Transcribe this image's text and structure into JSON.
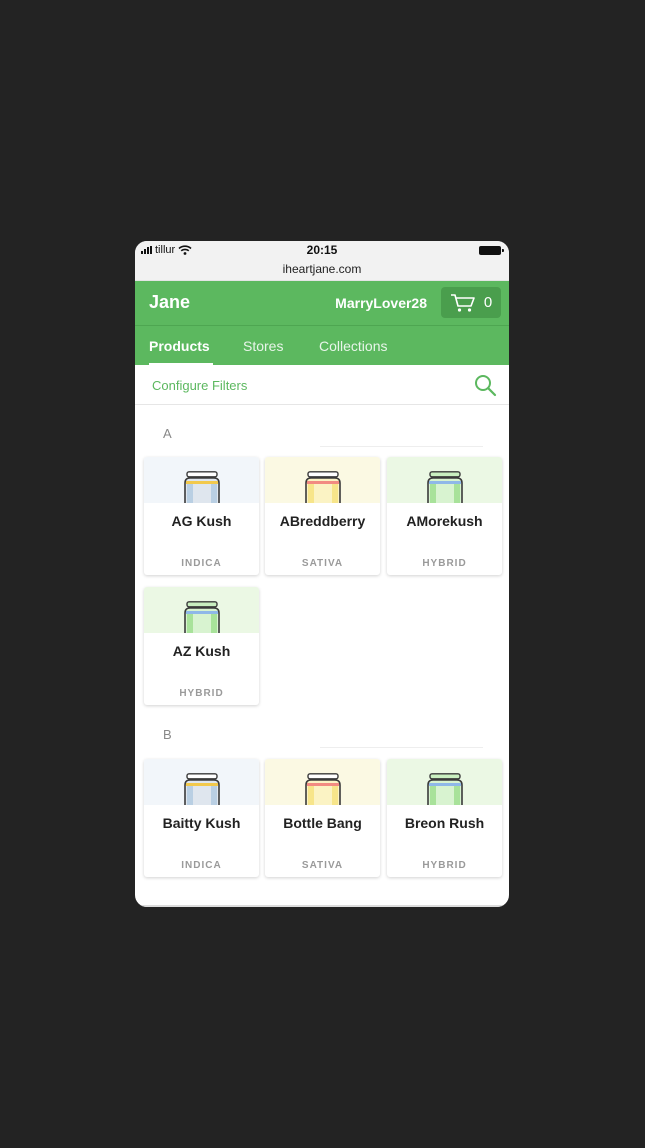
{
  "status": {
    "carrier": "tillur",
    "time": "20:15"
  },
  "browser": {
    "url": "iheartjane.com"
  },
  "header": {
    "brand": "Jane",
    "username": "MarryLover28",
    "cart_count": "0"
  },
  "tabs": [
    {
      "label": "Products",
      "active": true
    },
    {
      "label": "Stores",
      "active": false
    },
    {
      "label": "Collections",
      "active": false
    }
  ],
  "filters": {
    "configure_label": "Configure Filters"
  },
  "sections": [
    {
      "letter": "A",
      "products": [
        {
          "name": "AG Kush",
          "type": "INDICA"
        },
        {
          "name": "ABreddberry",
          "type": "SATIVA"
        },
        {
          "name": "AMorekush",
          "type": "HYBRID"
        },
        {
          "name": "AZ Kush",
          "type": "HYBRID"
        }
      ]
    },
    {
      "letter": "B",
      "products": [
        {
          "name": "Baitty Kush",
          "type": "INDICA"
        },
        {
          "name": "Bottle Bang",
          "type": "SATIVA"
        },
        {
          "name": "Breon Rush",
          "type": "HYBRID"
        }
      ]
    }
  ],
  "colors": {
    "brand_green": "#5cb85f",
    "indica_band": "#f2f6fa",
    "sativa_band": "#fbf9e3",
    "hybrid_band": "#ebf8e4"
  }
}
